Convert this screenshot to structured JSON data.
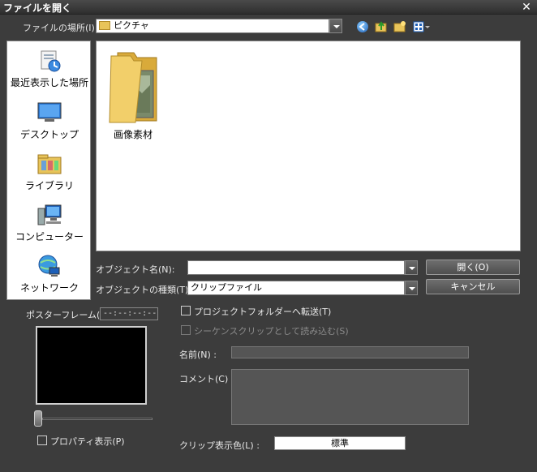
{
  "window": {
    "title": "ファイルを開く",
    "close_glyph": "✕"
  },
  "location": {
    "label": "ファイルの場所(I):",
    "value": "ピクチャ"
  },
  "places": [
    {
      "label": "最近表示した場所",
      "icon": "recent-places-icon"
    },
    {
      "label": "デスクトップ",
      "icon": "desktop-icon"
    },
    {
      "label": "ライブラリ",
      "icon": "libraries-icon"
    },
    {
      "label": "コンピューター",
      "icon": "computer-icon"
    },
    {
      "label": "ネットワーク",
      "icon": "network-icon"
    }
  ],
  "files": [
    {
      "name": "画像素材",
      "icon": "folder-icon"
    }
  ],
  "object_name": {
    "label": "オブジェクト名(N):",
    "value": ""
  },
  "object_type": {
    "label": "オブジェクトの種類(T):",
    "value": "クリップファイル"
  },
  "buttons": {
    "open": "開く(O)",
    "cancel": "キャンセル"
  },
  "poster_frame": {
    "label": "ポスターフレーム(R) :",
    "timecode": "--:--:--:--"
  },
  "properties_check": {
    "label": "プロパティ表示(P)",
    "checked": false
  },
  "project_folder_check": {
    "label": "プロジェクトフォルダーへ転送(T)",
    "checked": false
  },
  "sequence_clip_check": {
    "label": "シーケンスクリップとして読み込む(S)",
    "checked": false
  },
  "name_field": {
    "label": "名前(N) :",
    "value": ""
  },
  "comment_field": {
    "label": "コメント(C) :",
    "value": ""
  },
  "clip_color": {
    "label": "クリップ表示色(L) :",
    "value": "標準"
  },
  "colors": {
    "background": "#3c3c3c",
    "panel": "#ffffff",
    "accent_blue": "#1d5fb8",
    "folder_yellow": "#e8c45a"
  }
}
